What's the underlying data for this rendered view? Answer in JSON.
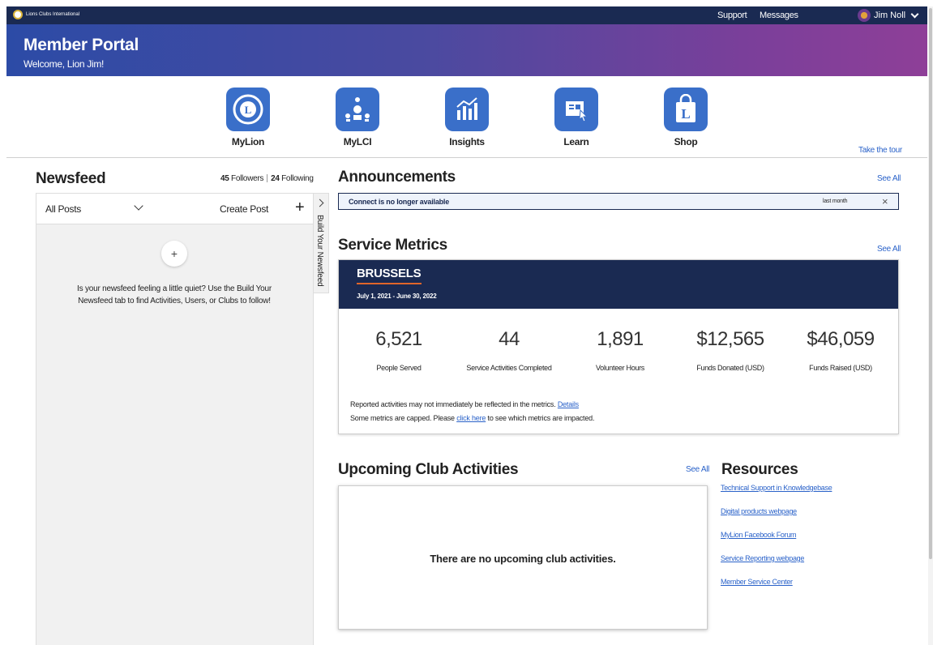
{
  "topbar": {
    "org_name": "Lions Clubs International",
    "support": "Support",
    "messages": "Messages",
    "user_name": "Jim Noll"
  },
  "hero": {
    "title": "Member Portal",
    "welcome": "Welcome, Lion Jim!"
  },
  "apps": [
    {
      "label": "MyLion",
      "icon": "lion-logo-icon"
    },
    {
      "label": "MyLCI",
      "icon": "org-chart-icon"
    },
    {
      "label": "Insights",
      "icon": "chart-icon"
    },
    {
      "label": "Learn",
      "icon": "book-icon"
    },
    {
      "label": "Shop",
      "icon": "shopping-bag-icon"
    }
  ],
  "tour_link": "Take the tour",
  "newsfeed": {
    "title": "Newsfeed",
    "followers_count": "45",
    "followers_label": "Followers",
    "following_count": "24",
    "following_label": "Following",
    "filter": "All Posts",
    "create_post": "Create Post",
    "empty_message": "Is your newsfeed feeling a little quiet? Use the Build Your Newsfeed tab to find Activities, Users, or Clubs to follow!",
    "build_tab": "Build Your Newsfeed"
  },
  "announcements": {
    "title": "Announcements",
    "see_all": "See All",
    "item": {
      "message": "Connect is no longer available",
      "time": "last month"
    }
  },
  "service_metrics": {
    "title": "Service Metrics",
    "see_all": "See All",
    "city": "BRUSSELS",
    "date_range": "July 1, 2021 - June 30, 2022",
    "metrics": [
      {
        "value": "6,521",
        "label": "People Served"
      },
      {
        "value": "44",
        "label": "Service Activities Completed"
      },
      {
        "value": "1,891",
        "label": "Volunteer Hours"
      },
      {
        "value": "$12,565",
        "label": "Funds Donated (USD)"
      },
      {
        "value": "$46,059",
        "label": "Funds Raised (USD)"
      }
    ],
    "note1": "Reported activities may not immediately be reflected in the metrics.",
    "note1_link": "Details",
    "note2_prefix": "Some metrics are capped. Please",
    "note2_link": "click here",
    "note2_suffix": "to see which metrics are impacted."
  },
  "activities": {
    "title": "Upcoming Club Activities",
    "see_all": "See All",
    "empty": "There are no upcoming club activities."
  },
  "resources": {
    "title": "Resources",
    "links": [
      "Technical Support in Knowledgebase",
      "Digital products webpage",
      "MyLion Facebook Forum",
      "Service Reporting webpage",
      "Member Service Center"
    ]
  },
  "colors": {
    "navy": "#1a2a52",
    "tile_blue": "#3a6fc9",
    "link_blue": "#2a62c9",
    "accent_orange": "#e0652a"
  }
}
